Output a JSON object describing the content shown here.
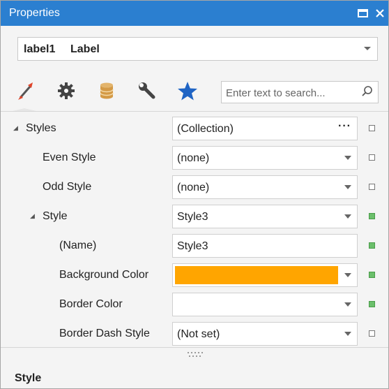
{
  "window": {
    "title": "Properties"
  },
  "selector": {
    "name": "label1",
    "type": "Label"
  },
  "tabs": [
    {
      "icon": "brush-icon",
      "label": "Appearance"
    },
    {
      "icon": "gear-icon",
      "label": "Behavior"
    },
    {
      "icon": "database-icon",
      "label": "Data"
    },
    {
      "icon": "wrench-icon",
      "label": "Design"
    },
    {
      "icon": "star-icon",
      "label": "Favorites"
    }
  ],
  "search": {
    "placeholder": "Enter text to search..."
  },
  "properties": [
    {
      "label": "Styles",
      "value": "(Collection)",
      "editor": "ellipsis",
      "expander": "◢",
      "modified": false
    },
    {
      "label": "Even Style",
      "value": "(none)",
      "editor": "dropdown",
      "modified": false
    },
    {
      "label": "Odd Style",
      "value": "(none)",
      "editor": "dropdown",
      "modified": false
    },
    {
      "label": "Style",
      "value": "Style3",
      "editor": "dropdown",
      "expander": "◢",
      "modified": true
    },
    {
      "label": "(Name)",
      "value": "Style3",
      "editor": "text",
      "modified": true
    },
    {
      "label": "Background Color",
      "value": "",
      "editor": "color",
      "color": "#FFA500",
      "modified": true
    },
    {
      "label": "Border Color",
      "value": "",
      "editor": "dropdown",
      "modified": true
    },
    {
      "label": "Border Dash Style",
      "value": "(Not set)",
      "editor": "dropdown",
      "modified": false
    }
  ],
  "description": {
    "title": "Style"
  },
  "colors": {
    "titlebar": "#2B7FD0",
    "accent": "#E0452A",
    "modified": "#6BBF6B"
  }
}
